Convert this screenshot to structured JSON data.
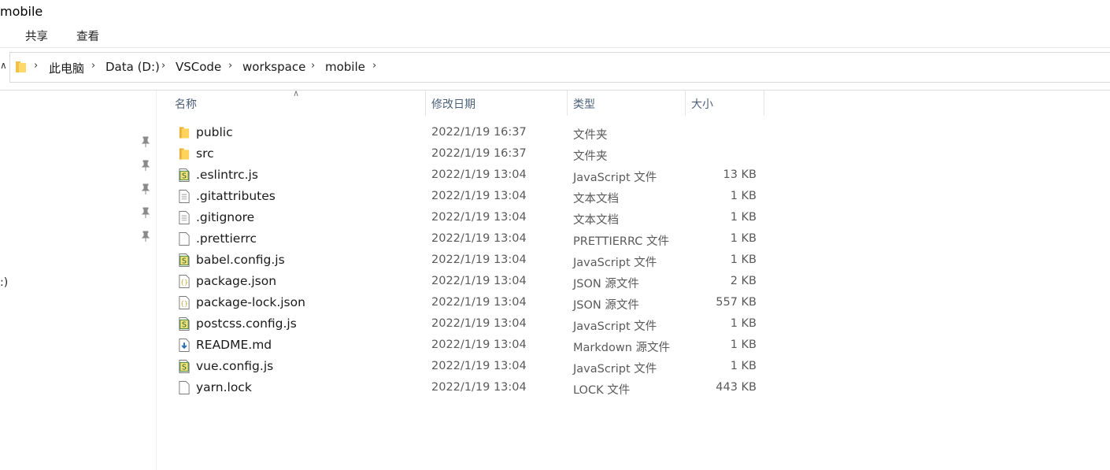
{
  "window": {
    "title": "mobile"
  },
  "ribbon": {
    "tabs": [
      "共享",
      "查看"
    ]
  },
  "address": {
    "crumbs": [
      "此电脑",
      "Data (D:)",
      "VSCode",
      "workspace",
      "mobile"
    ]
  },
  "nav": {
    "partial_text": ":)"
  },
  "columns": {
    "name": "名称",
    "date": "修改日期",
    "type": "类型",
    "size": "大小"
  },
  "files": [
    {
      "icon": "folder-icon",
      "name": "public",
      "date": "2022/1/19 16:37",
      "type": "文件夹",
      "size": ""
    },
    {
      "icon": "folder-icon",
      "name": "src",
      "date": "2022/1/19 16:37",
      "type": "文件夹",
      "size": ""
    },
    {
      "icon": "js-file-icon",
      "name": ".eslintrc.js",
      "date": "2022/1/19 13:04",
      "type": "JavaScript 文件",
      "size": "13 KB"
    },
    {
      "icon": "text-file-icon",
      "name": ".gitattributes",
      "date": "2022/1/19 13:04",
      "type": "文本文档",
      "size": "1 KB"
    },
    {
      "icon": "text-file-icon",
      "name": ".gitignore",
      "date": "2022/1/19 13:04",
      "type": "文本文档",
      "size": "1 KB"
    },
    {
      "icon": "blank-file-icon",
      "name": ".prettierrc",
      "date": "2022/1/19 13:04",
      "type": "PRETTIERRC 文件",
      "size": "1 KB"
    },
    {
      "icon": "js-file-icon",
      "name": "babel.config.js",
      "date": "2022/1/19 13:04",
      "type": "JavaScript 文件",
      "size": "1 KB"
    },
    {
      "icon": "json-file-icon",
      "name": "package.json",
      "date": "2022/1/19 13:04",
      "type": "JSON 源文件",
      "size": "2 KB"
    },
    {
      "icon": "json-file-icon",
      "name": "package-lock.json",
      "date": "2022/1/19 13:04",
      "type": "JSON 源文件",
      "size": "557 KB"
    },
    {
      "icon": "js-file-icon",
      "name": "postcss.config.js",
      "date": "2022/1/19 13:04",
      "type": "JavaScript 文件",
      "size": "1 KB"
    },
    {
      "icon": "markdown-file-icon",
      "name": "README.md",
      "date": "2022/1/19 13:04",
      "type": "Markdown 源文件",
      "size": "1 KB"
    },
    {
      "icon": "js-file-icon",
      "name": "vue.config.js",
      "date": "2022/1/19 13:04",
      "type": "JavaScript 文件",
      "size": "1 KB"
    },
    {
      "icon": "blank-file-icon",
      "name": "yarn.lock",
      "date": "2022/1/19 13:04",
      "type": "LOCK 文件",
      "size": "443 KB"
    }
  ]
}
